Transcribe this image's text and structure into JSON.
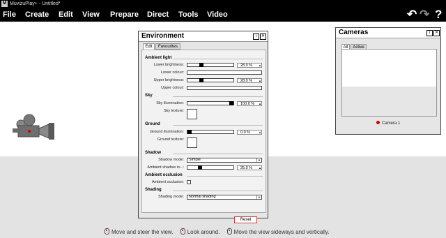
{
  "window": {
    "icon_letter": "M",
    "title": "MuvizuPlay+ - Untitled*"
  },
  "menu": [
    "File",
    "Create",
    "Edit",
    "View",
    "Prepare",
    "Direct",
    "Tools",
    "Video"
  ],
  "toolbar": {
    "undo": "↶",
    "redo": "↷",
    "help": "?"
  },
  "environment": {
    "title": "Environment",
    "tabs": [
      "Edit",
      "Favourites"
    ],
    "ambient_light": {
      "heading": "Ambient light",
      "lower_brightness_label": "Lower brightness:",
      "lower_brightness_value": "28.0 %",
      "lower_brightness_level": 0.28,
      "lower_colour_label": "Lower colour:",
      "upper_brightness_label": "Upper brightness:",
      "upper_brightness_value": "28.0 %",
      "upper_brightness_level": 0.28,
      "upper_colour_label": "Upper colour:"
    },
    "sky": {
      "heading": "Sky",
      "illumination_label": "Sky illumination:",
      "illumination_value": "100.0 %",
      "illumination_level": 1.0,
      "texture_label": "Sky texture:"
    },
    "ground": {
      "heading": "Ground",
      "illumination_label": "Ground illumination:",
      "illumination_value": "0.0 %",
      "illumination_level": 0.0,
      "texture_label": "Ground texture:"
    },
    "shadow": {
      "heading": "Shadow",
      "mode_label": "Shadow mode:",
      "mode_value": "Simple",
      "ambient_label": "Ambient shadow in...:",
      "ambient_value": "25.0 %",
      "ambient_level": 0.25
    },
    "ambient_occlusion": {
      "heading": "Ambient occlusion",
      "label": "Ambient occlusion:"
    },
    "shading": {
      "heading": "Shading",
      "mode_label": "Shading mode:",
      "mode_value": "Normal shading"
    },
    "reset_label": "Reset"
  },
  "cameras": {
    "title": "Cameras",
    "tabs": [
      "All",
      "Active"
    ],
    "active_camera": "Camera 1"
  },
  "hints": [
    "Move and steer the view.",
    "Look around.",
    "Move the view sideways and vertically."
  ],
  "colors": {
    "bar": "#000000",
    "ground": "#e3e3e3",
    "accent": "#cc0000"
  }
}
